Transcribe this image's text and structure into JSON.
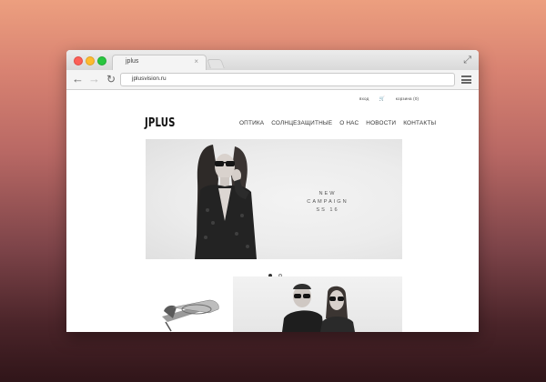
{
  "browser": {
    "tab_title": "jplus",
    "tab_close": "×",
    "address_url": "jplusvision.ru",
    "icons": [
      "back-icon",
      "forward-icon",
      "reload-icon",
      "menu-icon",
      "fullscreen-icon",
      "close-icon"
    ]
  },
  "site": {
    "top_links": {
      "login": "вход",
      "cart": "корзина (0)"
    },
    "logo": "JPLUS",
    "nav": [
      "ОПТИКА",
      "СОЛНЦЕЗАЩИТНЫЕ",
      "О НАС",
      "НОВОСТИ",
      "КОНТАКТЫ"
    ],
    "hero": {
      "line1": "NEW CAMPAIGN",
      "line2": "SS 16"
    },
    "slider": {
      "count": 2,
      "active": 1
    }
  },
  "colors": {
    "background_top": "#ec9f7f",
    "background_bottom": "#301519",
    "close": "#fc5f57",
    "minimize": "#fdbb2e",
    "maximize": "#29c63f"
  }
}
